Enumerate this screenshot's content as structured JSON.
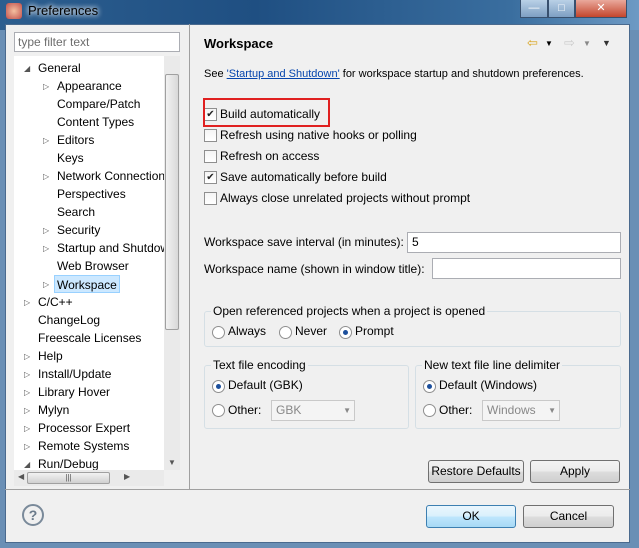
{
  "window": {
    "title": "Preferences"
  },
  "filter": {
    "placeholder": "type filter text"
  },
  "tree": [
    {
      "label": "General",
      "level": 0,
      "expander": "expanded"
    },
    {
      "label": "Appearance",
      "level": 1,
      "expander": "collapsed"
    },
    {
      "label": "Compare/Patch",
      "level": 1,
      "expander": "none"
    },
    {
      "label": "Content Types",
      "level": 1,
      "expander": "none"
    },
    {
      "label": "Editors",
      "level": 1,
      "expander": "collapsed"
    },
    {
      "label": "Keys",
      "level": 1,
      "expander": "none"
    },
    {
      "label": "Network Connections",
      "level": 1,
      "expander": "collapsed"
    },
    {
      "label": "Perspectives",
      "level": 1,
      "expander": "none"
    },
    {
      "label": "Search",
      "level": 1,
      "expander": "none"
    },
    {
      "label": "Security",
      "level": 1,
      "expander": "collapsed"
    },
    {
      "label": "Startup and Shutdown",
      "level": 1,
      "expander": "collapsed"
    },
    {
      "label": "Web Browser",
      "level": 1,
      "expander": "none"
    },
    {
      "label": "Workspace",
      "level": 1,
      "expander": "collapsed",
      "selected": true
    },
    {
      "label": "C/C++",
      "level": 0,
      "expander": "collapsed"
    },
    {
      "label": "ChangeLog",
      "level": 0,
      "expander": "none"
    },
    {
      "label": "Freescale Licenses",
      "level": 0,
      "expander": "none"
    },
    {
      "label": "Help",
      "level": 0,
      "expander": "collapsed"
    },
    {
      "label": "Install/Update",
      "level": 0,
      "expander": "collapsed"
    },
    {
      "label": "Library Hover",
      "level": 0,
      "expander": "collapsed"
    },
    {
      "label": "Mylyn",
      "level": 0,
      "expander": "collapsed"
    },
    {
      "label": "Processor Expert",
      "level": 0,
      "expander": "collapsed"
    },
    {
      "label": "Remote Systems",
      "level": 0,
      "expander": "collapsed"
    },
    {
      "label": "Run/Debug",
      "level": 0,
      "expander": "expanded"
    }
  ],
  "page": {
    "title": "Workspace",
    "intro_prefix": "See ",
    "intro_link": "'Startup and Shutdown'",
    "intro_suffix": " for workspace startup and shutdown preferences.",
    "checkboxes": [
      {
        "label": "Build automatically",
        "checked": true,
        "highlighted": true
      },
      {
        "label": "Refresh using native hooks or polling",
        "checked": false
      },
      {
        "label": "Refresh on access",
        "checked": false
      },
      {
        "label": "Save automatically before build",
        "checked": true
      },
      {
        "label": "Always close unrelated projects without prompt",
        "checked": false
      }
    ],
    "save_interval_label": "Workspace save interval (in minutes):",
    "save_interval_value": "5",
    "workspace_name_label": "Workspace name (shown in window title):",
    "workspace_name_value": "",
    "open_ref": {
      "title": "Open referenced projects when a project is opened",
      "options": [
        "Always",
        "Never",
        "Prompt"
      ],
      "selected": "Prompt"
    },
    "encoding": {
      "title": "Text file encoding",
      "default_label": "Default (GBK)",
      "other_label": "Other:",
      "other_value": "GBK",
      "selected": "default"
    },
    "delimiter": {
      "title": "New text file line delimiter",
      "default_label": "Default (Windows)",
      "other_label": "Other:",
      "other_value": "Windows",
      "selected": "default"
    },
    "restore_defaults": "Restore Defaults",
    "apply": "Apply"
  },
  "buttons": {
    "ok": "OK",
    "cancel": "Cancel"
  },
  "colors": {
    "highlight": "#e02020",
    "link": "#0645ad",
    "selection": "#cce8ff"
  }
}
